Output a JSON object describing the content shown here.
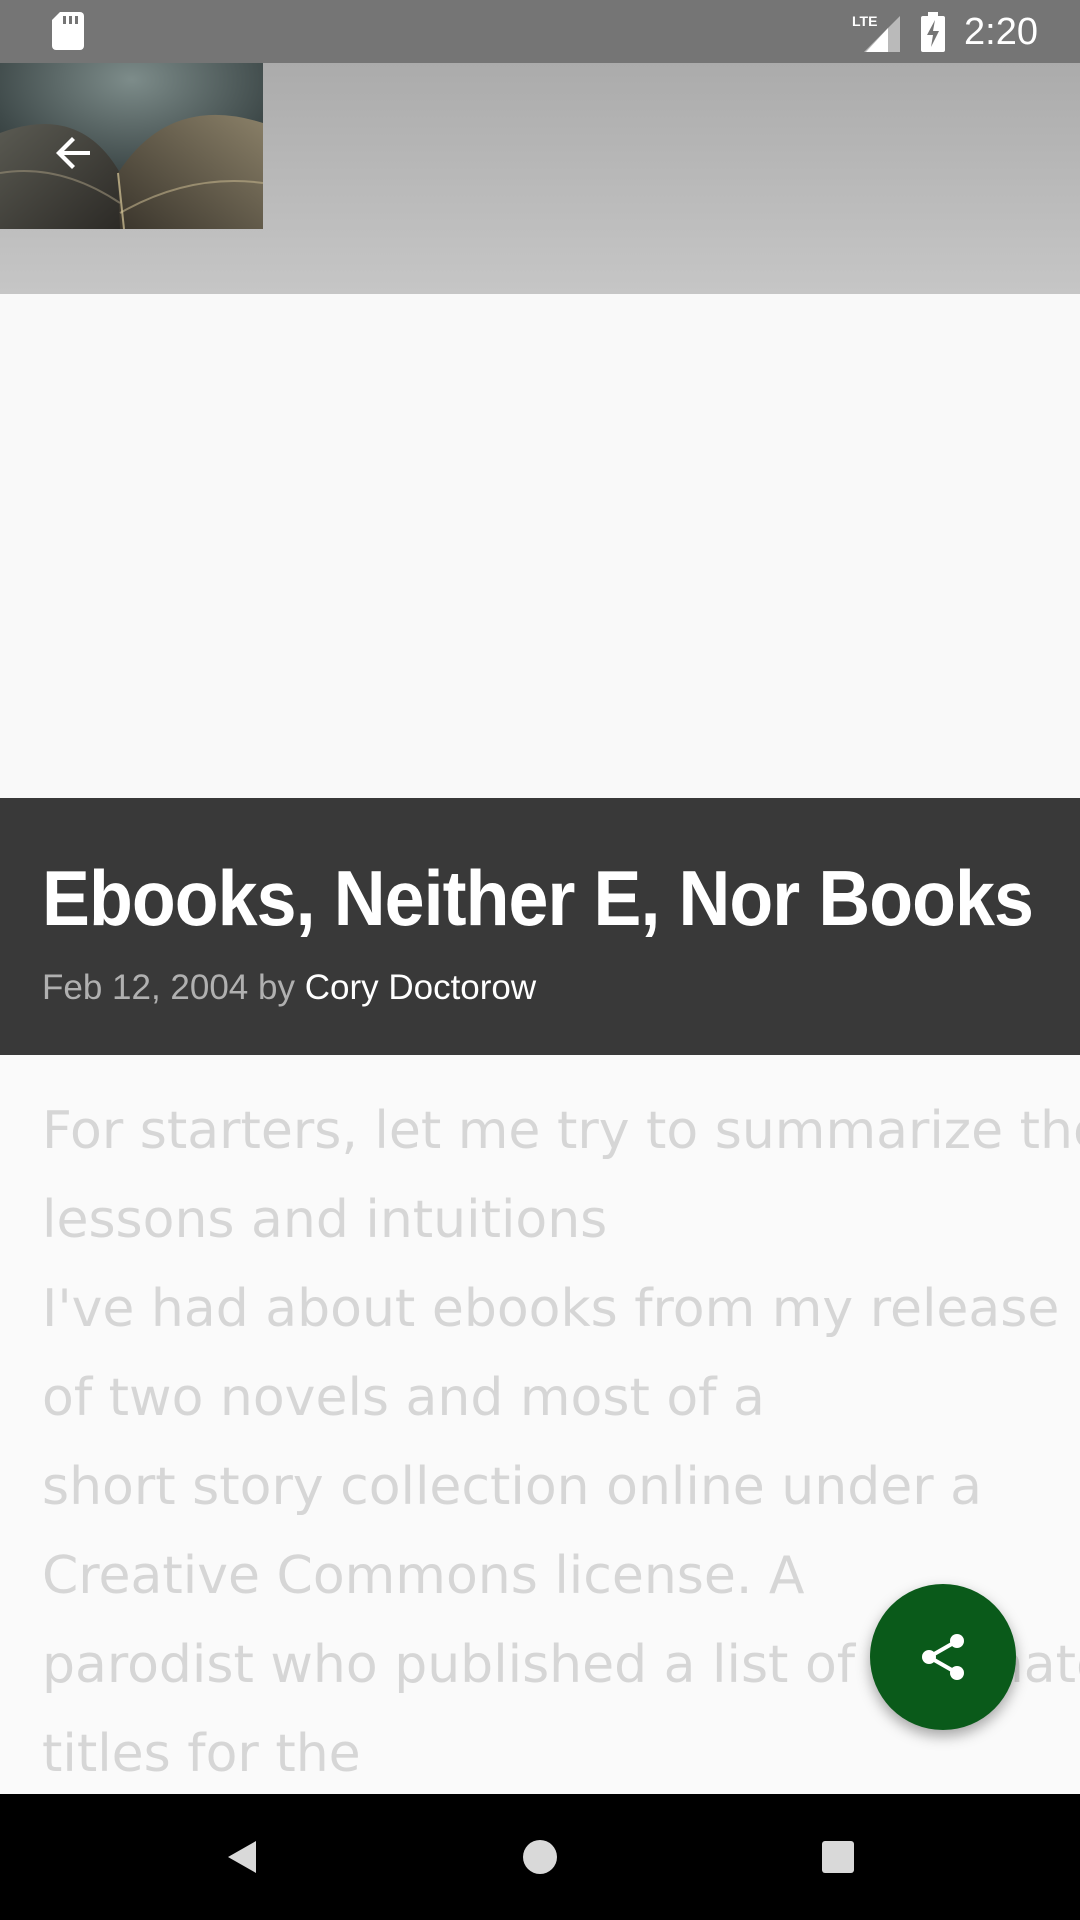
{
  "status_bar": {
    "time": "2:20",
    "network": "LTE",
    "icons": [
      "sd-card-icon",
      "signal-icon",
      "battery-charging-icon"
    ]
  },
  "header": {
    "back_icon": "arrow-back-icon"
  },
  "article": {
    "title": "Ebooks, Neither E, Nor Books",
    "date": "Feb 12, 2004",
    "by": "by",
    "author": "Cory Doctorow",
    "body_lines": [
      "For starters, let me try to summarize the",
      "lessons and intuitions",
      "I've had about ebooks from my release",
      "of two novels and most of a",
      "short story collection online under a",
      "Creative Commons license. A",
      "parodist who published a list of alternate",
      "titles for the"
    ]
  },
  "fab": {
    "icon": "share-icon"
  },
  "nav_bar": {
    "icons": [
      "back-triangle-icon",
      "home-circle-icon",
      "recents-square-icon"
    ]
  },
  "colors": {
    "title_block": "#393939",
    "fab": "#0a5a1a",
    "status_bar": "#757575"
  }
}
